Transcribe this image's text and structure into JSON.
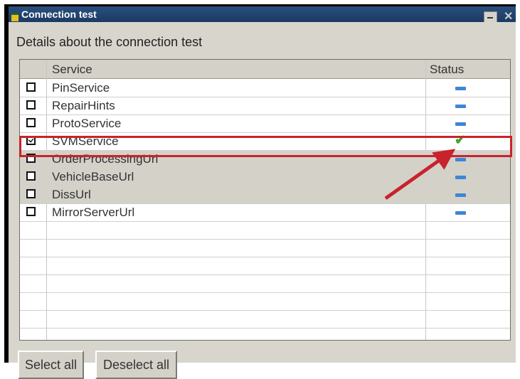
{
  "window": {
    "title": "Connection test"
  },
  "subtitle": "Details about the connection test",
  "table": {
    "headers": {
      "service": "Service",
      "status": "Status"
    },
    "rows": [
      {
        "service": "PinService",
        "checked": false,
        "status": "dash",
        "shaded": false
      },
      {
        "service": "RepairHints",
        "checked": false,
        "status": "dash",
        "shaded": false
      },
      {
        "service": "ProtoService",
        "checked": false,
        "status": "dash",
        "shaded": false
      },
      {
        "service": "SVMService",
        "checked": true,
        "status": "check",
        "shaded": false
      },
      {
        "service": "OrderProcessingUrl",
        "checked": false,
        "status": "dash",
        "shaded": true
      },
      {
        "service": "VehicleBaseUrl",
        "checked": false,
        "status": "dash",
        "shaded": true
      },
      {
        "service": "DissUrl",
        "checked": false,
        "status": "dash",
        "shaded": true
      },
      {
        "service": "MirrorServerUrl",
        "checked": false,
        "status": "dash",
        "shaded": false
      }
    ]
  },
  "buttons": {
    "select_all": "Select all",
    "deselect_all": "Deselect all"
  },
  "colors": {
    "annotation": "#c8232c",
    "status_ok": "#3aa829",
    "status_pending": "#3d86d6"
  }
}
